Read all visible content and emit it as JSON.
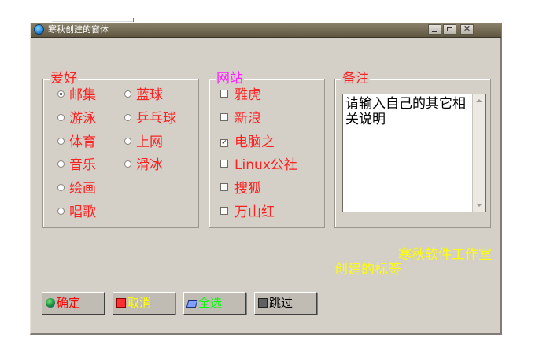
{
  "window": {
    "title": "寒秋创建的窗体"
  },
  "hobby": {
    "label": "爱好",
    "options": [
      "邮集",
      "游泳",
      "体育",
      "音乐",
      "绘画",
      "唱歌",
      "蓝球",
      "乒乓球",
      "上网",
      "滑冰"
    ],
    "selected": "邮集"
  },
  "site": {
    "label": "网站",
    "options": [
      "雅虎",
      "新浪",
      "电脑之",
      "Linux公社",
      "搜狐",
      "万山红"
    ],
    "checked": [
      "电脑之"
    ]
  },
  "note": {
    "label": "备注",
    "text": "请输入自己的其它相关说明"
  },
  "yellow_label": {
    "line1": "寒秋软件工作室",
    "line2": "创建的标签"
  },
  "buttons": {
    "ok": "确定",
    "cancel": "取消",
    "select_all": "全选",
    "skip": "跳过"
  },
  "colors": {
    "red_text": "#ff2020",
    "magenta": "#ff20ff",
    "yellow": "#ffff00",
    "green": "#00ff00"
  }
}
